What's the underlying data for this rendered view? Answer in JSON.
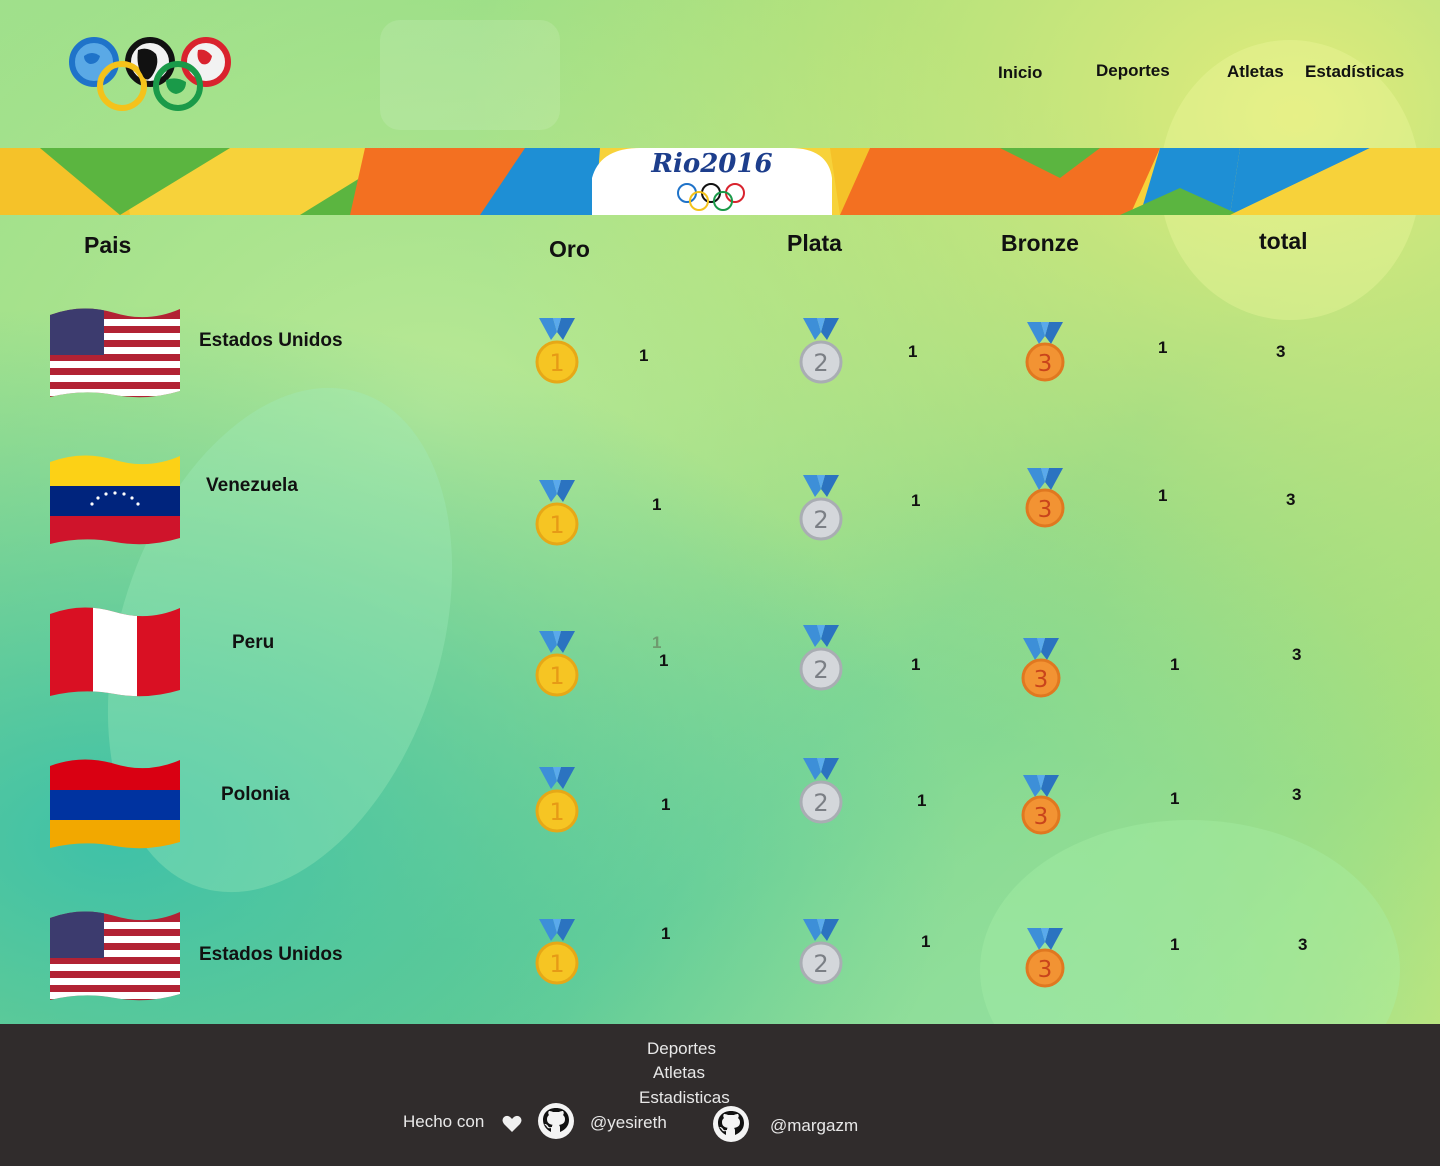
{
  "nav": {
    "inicio": "Inicio",
    "deportes": "Deportes",
    "atletas": "Atletas",
    "estadisticas": "Estadísticas"
  },
  "banner": {
    "brand": "Rio2016"
  },
  "table": {
    "headers": {
      "pais": "Pais",
      "oro": "Oro",
      "plata": "Plata",
      "bronze": "Bronze",
      "total": "total"
    },
    "rows": [
      {
        "country": "Estados Unidos",
        "flag": "usa-flag",
        "oro": "1",
        "plata": "1",
        "bronze": "1",
        "total": "3"
      },
      {
        "country": "Venezuela",
        "flag": "venezuela-flag",
        "oro": "1",
        "plata": "1",
        "bronze": "1",
        "total": "3"
      },
      {
        "country": "Peru",
        "flag": "peru-flag",
        "oro": "1",
        "oro_extra": "1",
        "plata": "1",
        "bronze": "1",
        "total": "3"
      },
      {
        "country": "Polonia",
        "flag": "armenia-flag",
        "oro": "1",
        "plata": "1",
        "bronze": "1",
        "total": "3"
      },
      {
        "country": "Estados Unidos",
        "flag": "usa-flag",
        "oro": "1",
        "plata": "1",
        "bronze": "1",
        "total": "3"
      }
    ],
    "medal_labels": {
      "gold": "1",
      "silver": "2",
      "bronze": "3"
    }
  },
  "footer": {
    "deportes": "Deportes",
    "atletas": "Atletas",
    "estadisticas": "Estadisticas",
    "hecho_con": "Hecho con",
    "user1": "@yesireth",
    "user2": "@margazm"
  },
  "colors": {
    "gold": "#f6c523",
    "silver": "#c9ccd1",
    "bronze": "#ef8a2a",
    "ribbon": "#3d8fd8",
    "footer_bg": "#302c2c"
  }
}
